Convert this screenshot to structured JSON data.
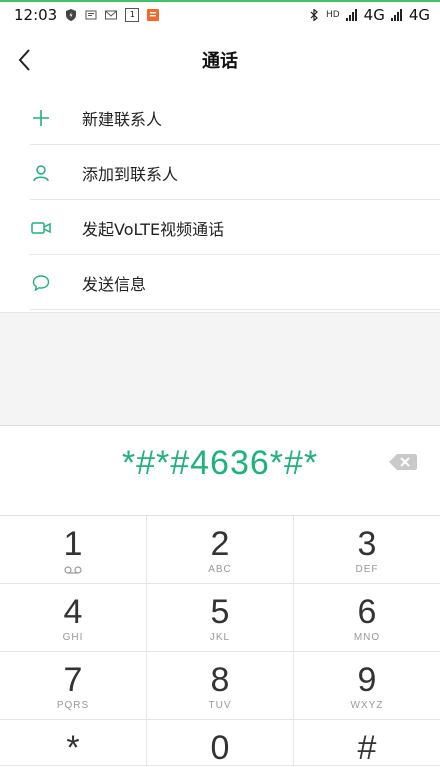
{
  "status_bar": {
    "time": "12:03",
    "notif_badge": "1",
    "hd_label": "HD",
    "network1": "4G",
    "network2": "4G",
    "lte_small": "ıl"
  },
  "header": {
    "title": "通话"
  },
  "menu": {
    "items": [
      {
        "label": "新建联系人",
        "icon": "plus-icon"
      },
      {
        "label": "添加到联系人",
        "icon": "person-icon"
      },
      {
        "label": "发起VoLTE视频通话",
        "icon": "video-icon"
      },
      {
        "label": "发送信息",
        "icon": "message-icon"
      }
    ]
  },
  "dialer": {
    "number": "*#*#4636*#*"
  },
  "keypad": {
    "keys": [
      {
        "digit": "1",
        "letters": ""
      },
      {
        "digit": "2",
        "letters": "ABC"
      },
      {
        "digit": "3",
        "letters": "DEF"
      },
      {
        "digit": "4",
        "letters": "GHI"
      },
      {
        "digit": "5",
        "letters": "JKL"
      },
      {
        "digit": "6",
        "letters": "MNO"
      },
      {
        "digit": "7",
        "letters": "PQRS"
      },
      {
        "digit": "8",
        "letters": "TUV"
      },
      {
        "digit": "9",
        "letters": "WXYZ"
      },
      {
        "digit": "*",
        "letters": ""
      },
      {
        "digit": "0",
        "letters": ""
      },
      {
        "digit": "#",
        "letters": ""
      }
    ]
  },
  "colors": {
    "accent": "#1fb27a",
    "top_bar": "#3ec36a"
  }
}
